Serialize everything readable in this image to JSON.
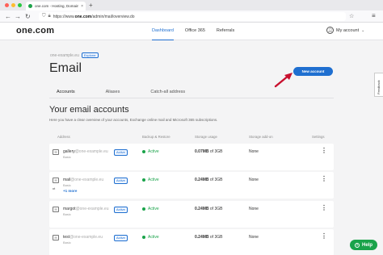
{
  "browser": {
    "tab_title": "one.com - Hosting, Domain, E-m",
    "tab_close": "×",
    "new_tab": "+",
    "url_host": "one.com",
    "url_prefix": "https://www.",
    "url_path": "/admin/mail/overview.do",
    "back": "←",
    "forward": "→",
    "reload": "↻",
    "bookmark": "☆",
    "menu": "≡"
  },
  "header": {
    "logo": "one.com",
    "nav": [
      "Dashboard",
      "Office 365",
      "Referrals"
    ],
    "account_label": "My account",
    "active_nav_color": "#1f6fd0"
  },
  "page": {
    "domain": "one-example.eu",
    "domain_tag": "Explorer",
    "title": "Email",
    "new_account_button": "New account",
    "tabs": [
      "Accounts",
      "Aliases",
      "Catch-all address"
    ],
    "section_title": "Your email accounts",
    "section_desc": "Here you have a clear overview of your accounts, Exchange online mail and Microsoft 365 subscriptions."
  },
  "table": {
    "columns": [
      "Address",
      "Backup & Restore",
      "Storage usage",
      "Storage add-on",
      "Settings"
    ],
    "rows": [
      {
        "local": "gallery",
        "domain": "@one-example.eu",
        "plan": "Basic",
        "badge": "Active",
        "status": "Active",
        "used": "0.07MB",
        "of": "of",
        "total": "3GB",
        "addon": "None",
        "more": ""
      },
      {
        "local": "mail",
        "domain": "@one-example.eu",
        "plan": "Basic",
        "badge": "Active",
        "status": "Active",
        "used": "0.24MB",
        "of": "of",
        "total": "3GB",
        "addon": "None",
        "more": "+1 more"
      },
      {
        "local": "margot",
        "domain": "@one-example.eu",
        "plan": "Basic",
        "badge": "Active",
        "status": "Active",
        "used": "0.24MB",
        "of": "of",
        "total": "3GB",
        "addon": "None",
        "more": ""
      },
      {
        "local": "test",
        "domain": "@one-example.eu",
        "plan": "Basic",
        "badge": "Active",
        "status": "Active",
        "used": "0.24MB",
        "of": "of",
        "total": "3GB",
        "addon": "None",
        "more": ""
      }
    ]
  },
  "feedback_label": "Feedback",
  "help_label": "Help",
  "colors": {
    "accent": "#1f6fd0",
    "success": "#1aa34a",
    "arrow": "#c8102e"
  }
}
